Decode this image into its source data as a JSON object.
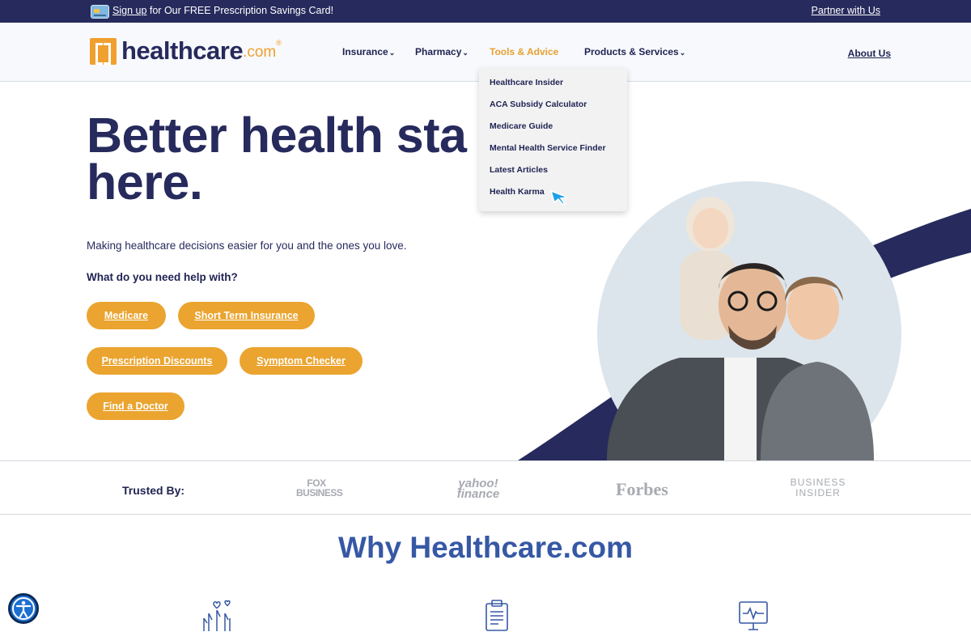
{
  "promo": {
    "signup_link": "Sign up",
    "message": " for Our FREE Prescription Savings Card!",
    "partner": "Partner with Us"
  },
  "header": {
    "logo_word": "healthcare",
    "logo_suffix": ".com",
    "logo_reg": "®",
    "nav": [
      {
        "label": "Insurance",
        "has_menu": true
      },
      {
        "label": "Pharmacy",
        "has_menu": true
      },
      {
        "label": "Tools & Advice",
        "has_menu": false,
        "active": true
      },
      {
        "label": "Products & Services",
        "has_menu": true
      }
    ],
    "about": "About Us",
    "chevron": "⌄"
  },
  "dropdown": {
    "items": [
      "Healthcare Insider",
      "ACA Subsidy Calculator",
      "Medicare Guide",
      "Mental Health Service Finder",
      "Latest Articles",
      "Health Karma"
    ]
  },
  "hero": {
    "title_line1": "Better health sta",
    "title_line2": "here.",
    "subtitle": "Making healthcare decisions easier for you and the ones you love.",
    "question": "What do you need help with?",
    "buttons": [
      "Medicare",
      "Short Term Insurance",
      "Prescription Discounts",
      "Symptom Checker",
      "Find a Doctor"
    ]
  },
  "trusted": {
    "label": "Trusted By:",
    "brands": [
      "FOX BUSINESS",
      "yahoo! finance",
      "Forbes",
      "BUSINESS INSIDER"
    ]
  },
  "why": {
    "title": "Why Healthcare.com"
  },
  "colors": {
    "navy": "#262a5c",
    "orange": "#eaa42f",
    "why_blue": "#3658a5"
  },
  "icons": [
    "credit-card-icon",
    "cursor-icon",
    "hands-icon",
    "clipboard-icon",
    "monitor-heart-icon",
    "accessibility-icon"
  ]
}
